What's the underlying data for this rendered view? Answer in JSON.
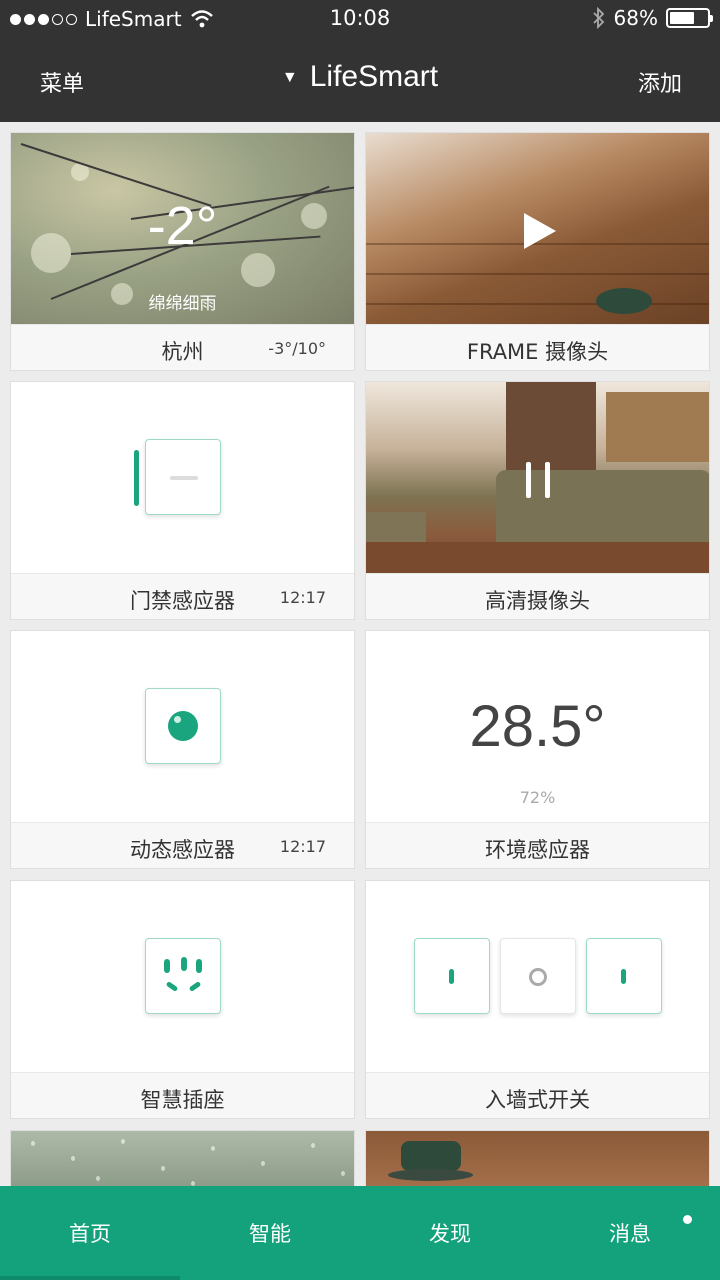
{
  "status": {
    "carrier": "LifeSmart",
    "time": "10:08",
    "battery": "68%",
    "battery_level": 0.68,
    "signal_filled": 3,
    "signal_total": 5
  },
  "nav": {
    "menu_label": "菜单",
    "brand": "LifeSmart",
    "add_label": "添加"
  },
  "cards": {
    "weather": {
      "temp": "-2°",
      "desc": "绵绵细雨",
      "city": "杭州",
      "range": "-3°/10°"
    },
    "frame_camera": {
      "name": "FRAME 摄像头"
    },
    "door_sensor": {
      "name": "门禁感应器",
      "time": "12:17"
    },
    "hd_camera": {
      "name": "高清摄像头"
    },
    "motion_sensor": {
      "name": "动态感应器",
      "time": "12:17"
    },
    "env_sensor": {
      "name": "环境感应器",
      "temperature": "28.5°",
      "humidity": "72%"
    },
    "smart_plug": {
      "name": "智慧插座"
    },
    "wall_switch": {
      "name": "入墙式开关"
    }
  },
  "tabs": [
    {
      "label": "首页"
    },
    {
      "label": "智能"
    },
    {
      "label": "发现"
    },
    {
      "label": "消息"
    }
  ],
  "colors": {
    "accent": "#14a27c",
    "header": "#333333"
  }
}
